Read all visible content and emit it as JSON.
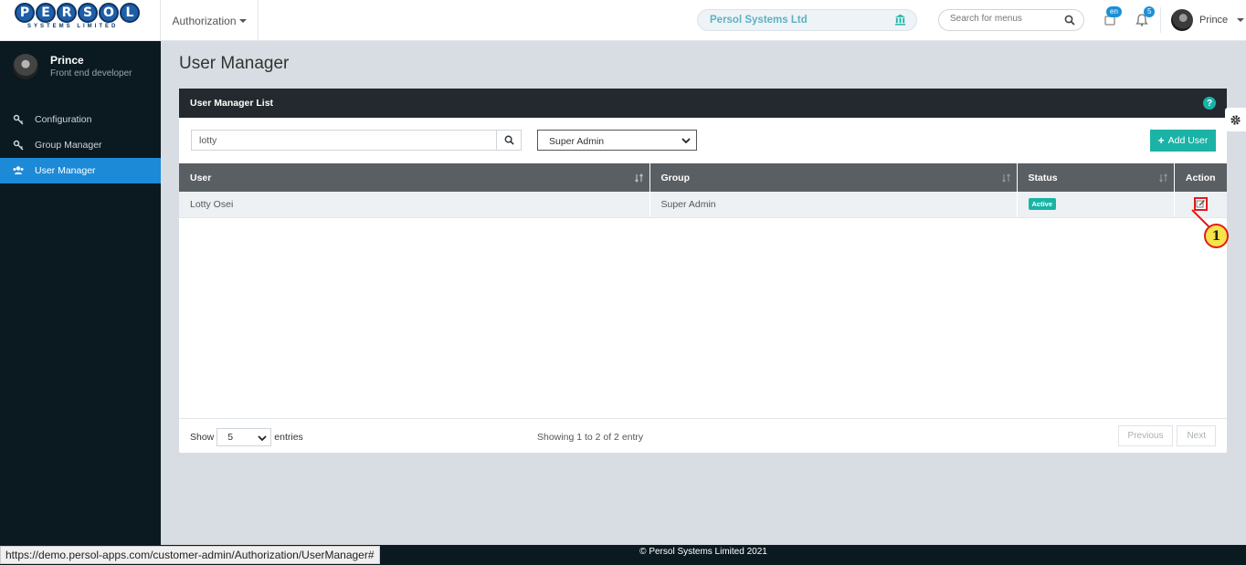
{
  "header": {
    "logo_text": "PERSOL",
    "logo_letters": [
      "P",
      "E",
      "R",
      "S",
      "O",
      "L"
    ],
    "logo_subtitle": "SYSTEMS LIMITED",
    "app_menu": "Authorization",
    "company": "Persol Systems Ltd",
    "search_placeholder": "Search for menus",
    "lang_badge": "en",
    "notif_count": "5",
    "user": "Prince"
  },
  "sidebar": {
    "name": "Prince",
    "role": "Front end developer",
    "items": [
      {
        "label": "Configuration",
        "icon": "key-icon"
      },
      {
        "label": "Group Manager",
        "icon": "key-icon"
      },
      {
        "label": "User Manager",
        "icon": "users-icon",
        "active": true
      }
    ]
  },
  "page": {
    "title": "User Manager",
    "panel_title": "User Manager List",
    "search_value": "lotty",
    "group_filter": "Super Admin",
    "add_button": "Add User"
  },
  "table": {
    "columns": [
      "User",
      "Group",
      "Status",
      "Action"
    ],
    "rows": [
      {
        "user": "Lotty Osei",
        "group": "Super Admin",
        "status": "Active"
      }
    ]
  },
  "footer_controls": {
    "show_label": "Show",
    "page_length": "5",
    "entries_label": "entries",
    "info": "Showing 1 to 2 of 2 entry",
    "previous": "Previous",
    "next": "Next"
  },
  "annotation": {
    "callout_number": "1"
  },
  "footer": {
    "copyright": "© Persol Systems Limited 2021"
  },
  "status_bar": {
    "url": "https://demo.persol-apps.com/customer-admin/Authorization/UserManager#"
  },
  "colors": {
    "accent": "#1ab3a6",
    "sidebar": "#0b1a20",
    "active_nav": "#1d8ad8",
    "callout_border": "#e31b1b"
  }
}
